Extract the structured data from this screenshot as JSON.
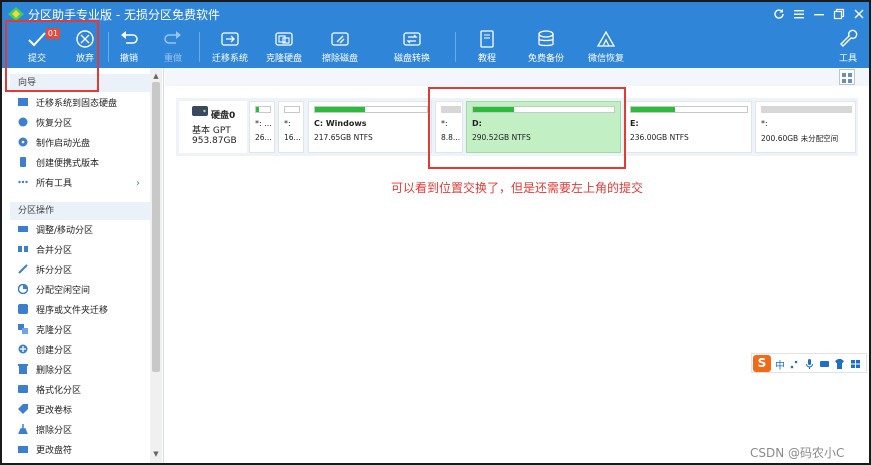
{
  "window": {
    "title": "分区助手专业版 - 无损分区免费软件",
    "controls": [
      "refresh-icon",
      "menu-icon",
      "minimize-icon",
      "restore-icon",
      "close-icon"
    ]
  },
  "toolbar": {
    "commit_label": "提交",
    "commit_badge": "01",
    "discard_label": "放弃",
    "undo_label": "撤销",
    "redo_label": "重做",
    "migrate_label": "迁移系统",
    "clone_label": "克隆硬盘",
    "wipe_label": "擦除磁盘",
    "convert_label": "磁盘转换",
    "tutorial_label": "教程",
    "backup_label": "免费备份",
    "wechat_label": "微信恢复",
    "tools_label": "工具"
  },
  "sidebar": {
    "wizard_title": "向导",
    "wizard_items": [
      "迁移系统到固态硬盘",
      "恢复分区",
      "制作启动光盘",
      "创建便携式版本",
      "所有工具"
    ],
    "ops_title": "分区操作",
    "ops_items": [
      "调整/移动分区",
      "合并分区",
      "拆分分区",
      "分配空闲空间",
      "程序或文件夹迁移",
      "克隆分区",
      "创建分区",
      "删除分区",
      "格式化分区",
      "更改卷标",
      "擦除分区",
      "更改盘符"
    ]
  },
  "disk": {
    "name": "硬盘0",
    "type": "基本 GPT",
    "size": "953.87GB",
    "partitions": [
      {
        "label": "*: ...",
        "desc": "26...",
        "used": 0.2,
        "selected": false,
        "bold": false
      },
      {
        "label": "*:",
        "desc": "16...",
        "used": 0.0,
        "selected": false,
        "bold": false
      },
      {
        "label": "C: Windows",
        "desc": "217.65GB NTFS",
        "used": 0.45,
        "selected": false,
        "bold": true
      },
      {
        "label": "*:",
        "desc": "8.8...",
        "used": 0.0,
        "selected": false,
        "bold": false
      },
      {
        "label": "D:",
        "desc": "290.52GB NTFS",
        "used": 0.29,
        "selected": true,
        "bold": true
      },
      {
        "label": "E:",
        "desc": "236.00GB NTFS",
        "used": 0.38,
        "selected": false,
        "bold": true
      },
      {
        "label": "*:",
        "desc": "200.60GB 未分配空间",
        "used": 0.0,
        "selected": false,
        "bold": false
      }
    ]
  },
  "annotation": {
    "text": "可以看到位置交换了，但是还需要左上角的提交"
  },
  "ime": {
    "logo": "S",
    "mode": "中"
  },
  "watermark": "CSDN @码农小C",
  "colors": {
    "accent": "#2f86d9",
    "annotation_red": "#e53935",
    "selected_partition": "#c2efc4",
    "usage_green": "#2dbb3a"
  }
}
